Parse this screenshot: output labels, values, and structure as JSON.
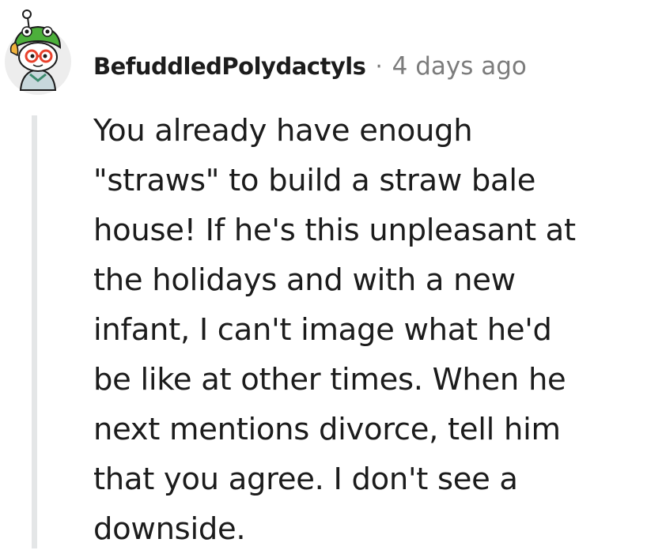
{
  "comment": {
    "username": "BefuddledPolydactyls",
    "separator": "·",
    "timestamp": "4 days ago",
    "body_lines": [
      "You already have enough",
      "\"straws\" to build a straw bale",
      "house! If he's this unpleasant at",
      "the holidays and with a new",
      "infant, I can't image what he'd",
      "be like at other times. When he",
      "next mentions divorce, tell him",
      "that you agree. I don't see a",
      "downside."
    ]
  },
  "avatar": {
    "icon": "snoo-avatar-frog-hat-icon",
    "hat_color": "#4caf3b",
    "glasses_color": "#e8412c",
    "ring_color": "#ededed"
  },
  "thread_line_color": "#e4e6e7"
}
